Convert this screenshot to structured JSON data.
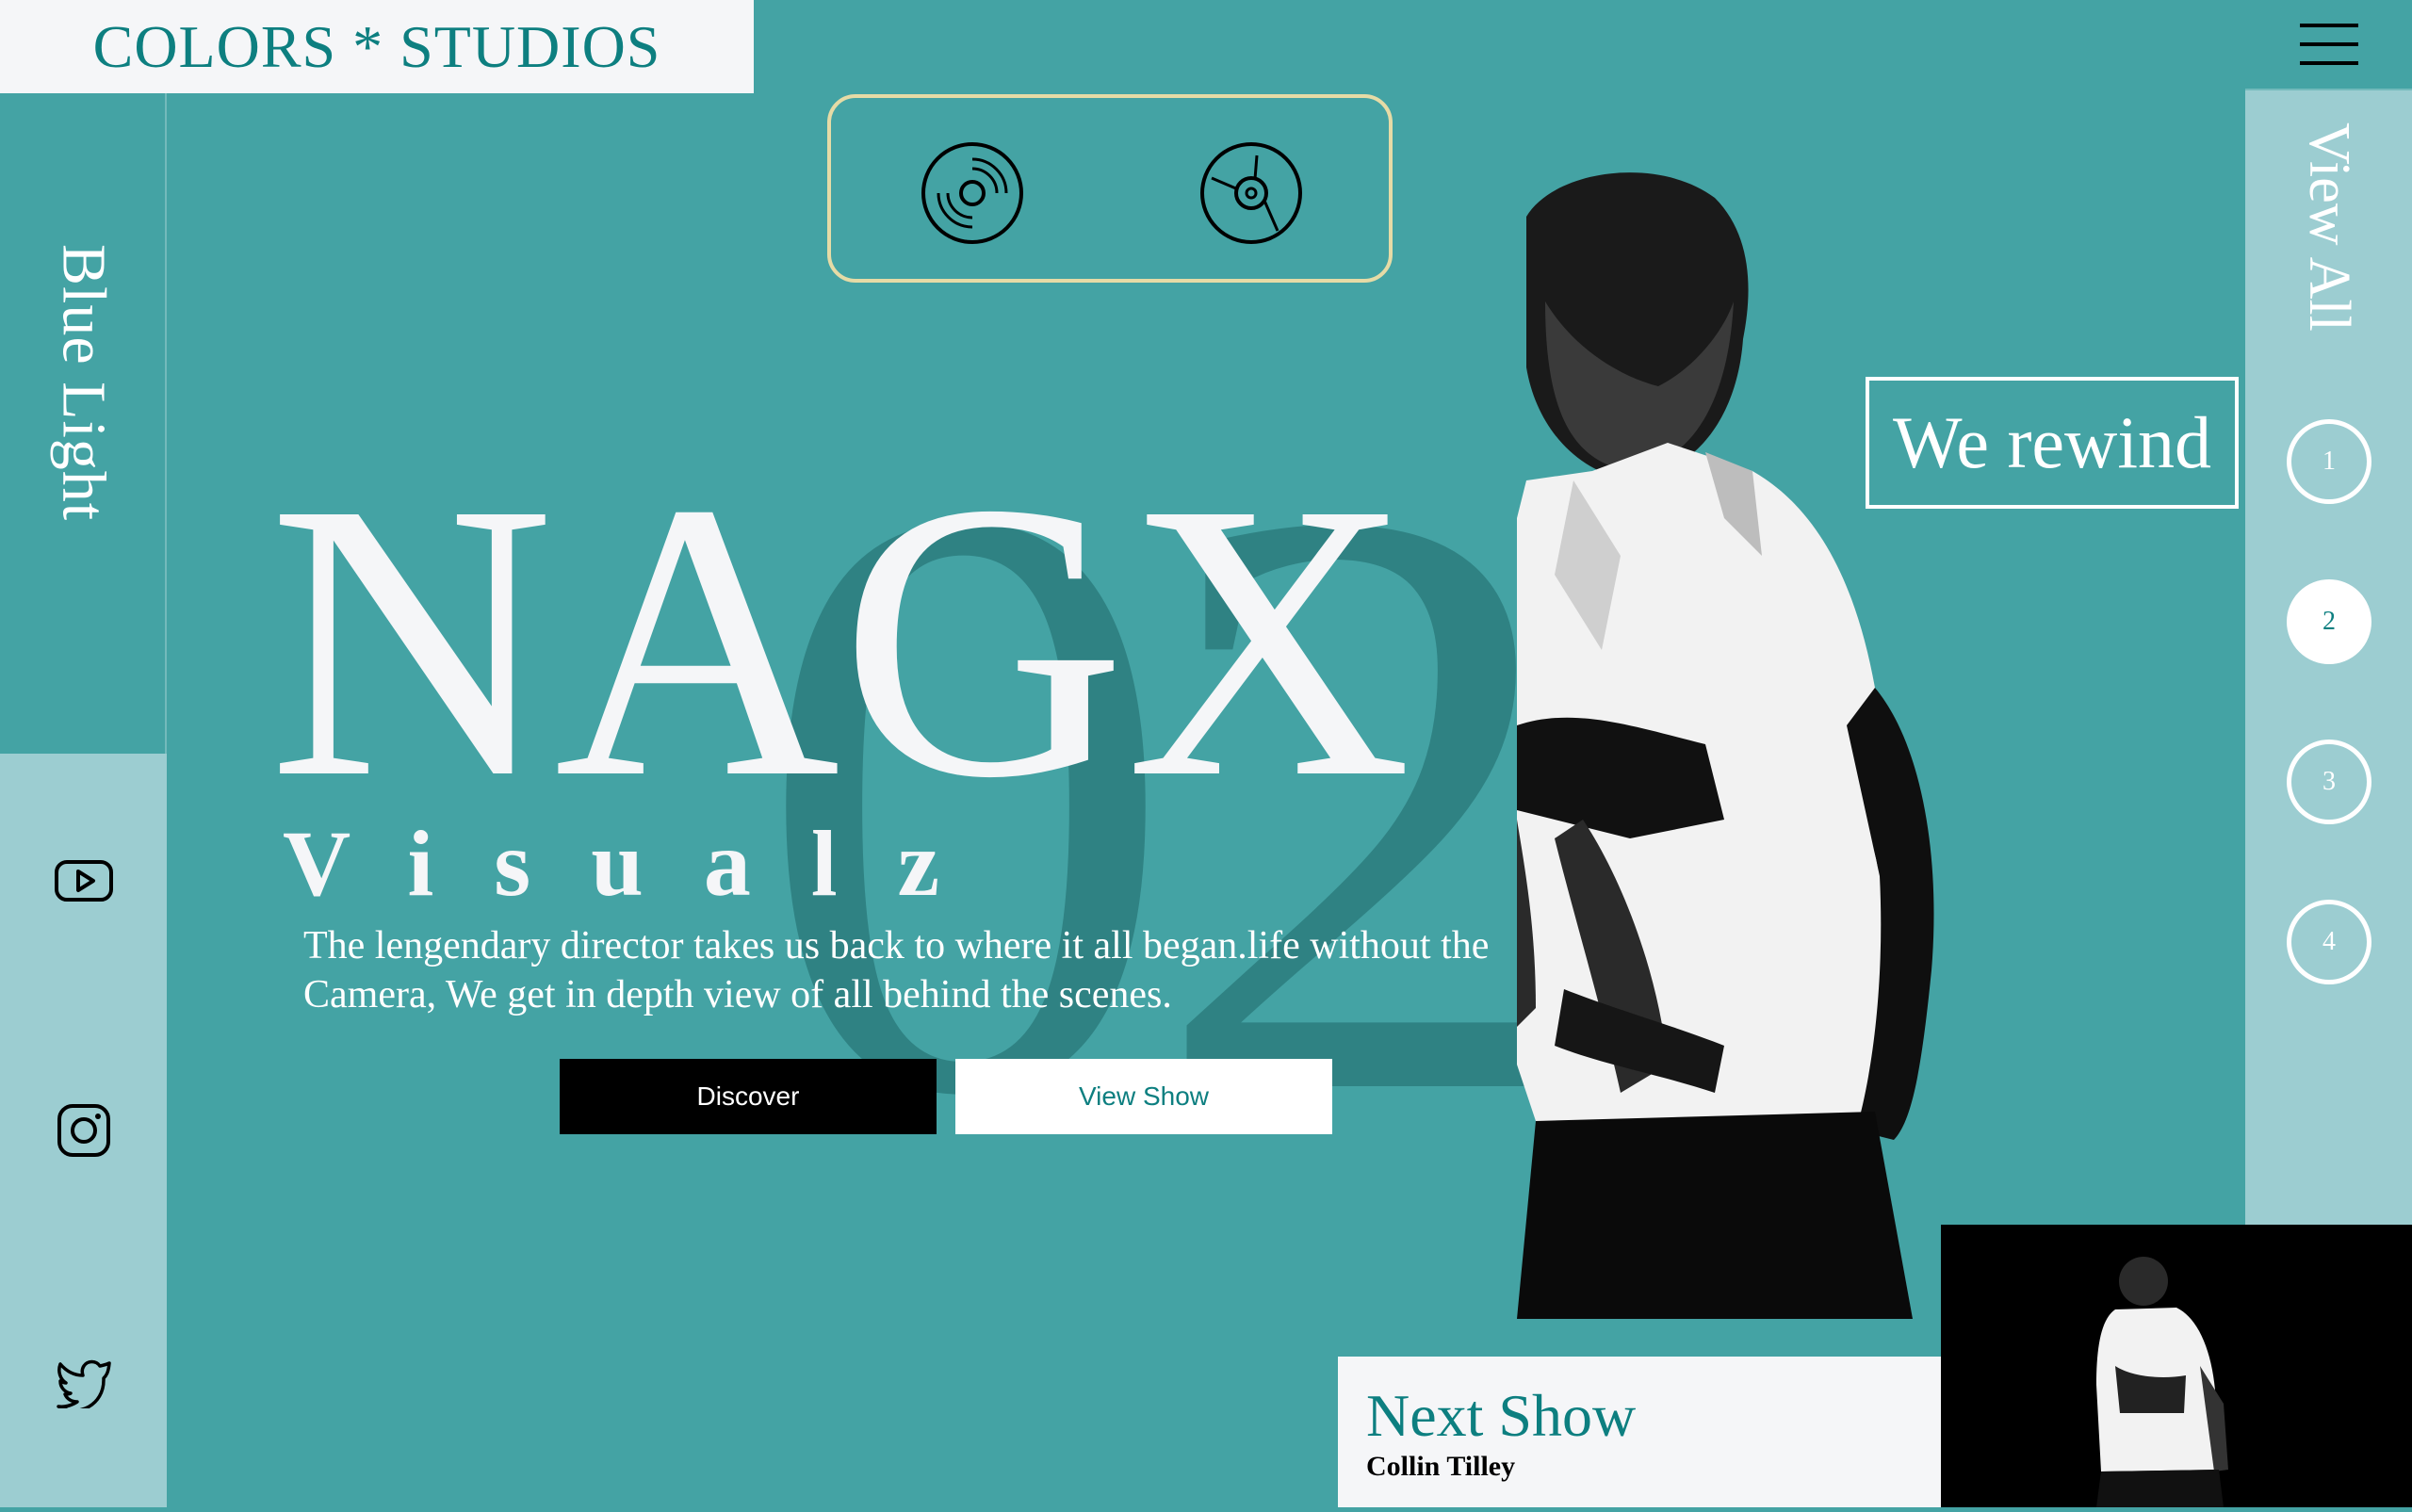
{
  "brand": {
    "logo": "COLORS * STUDIOS"
  },
  "sidebar_left": {
    "label": "Blue Light",
    "social": [
      {
        "name": "youtube-icon"
      },
      {
        "name": "instagram-icon"
      },
      {
        "name": "twitter-icon"
      }
    ]
  },
  "sidebar_right": {
    "menu_icon": "hamburger-menu-icon",
    "view_all": "View All",
    "pages": [
      "1",
      "2",
      "3",
      "4"
    ],
    "active_page": "2"
  },
  "disc_icons": [
    "vinyl-record-icon",
    "cd-disc-icon"
  ],
  "hero": {
    "background_number": "02",
    "title": "NAGX",
    "subtitle": "Visualz",
    "description": "The lengendary director takes us back to where it all began.life without the Camera, We get in depth view of all behind the scenes.",
    "discover_label": "Discover",
    "view_show_label": "View Show"
  },
  "rewind_label": "We rewind",
  "next_show": {
    "title": "Next Show",
    "name": "Collin Tilley"
  },
  "colors": {
    "background": "#44a3a4",
    "accent": "#0d7f80",
    "light_panel": "#9ccdd1",
    "border_gold": "#e6dba6"
  }
}
